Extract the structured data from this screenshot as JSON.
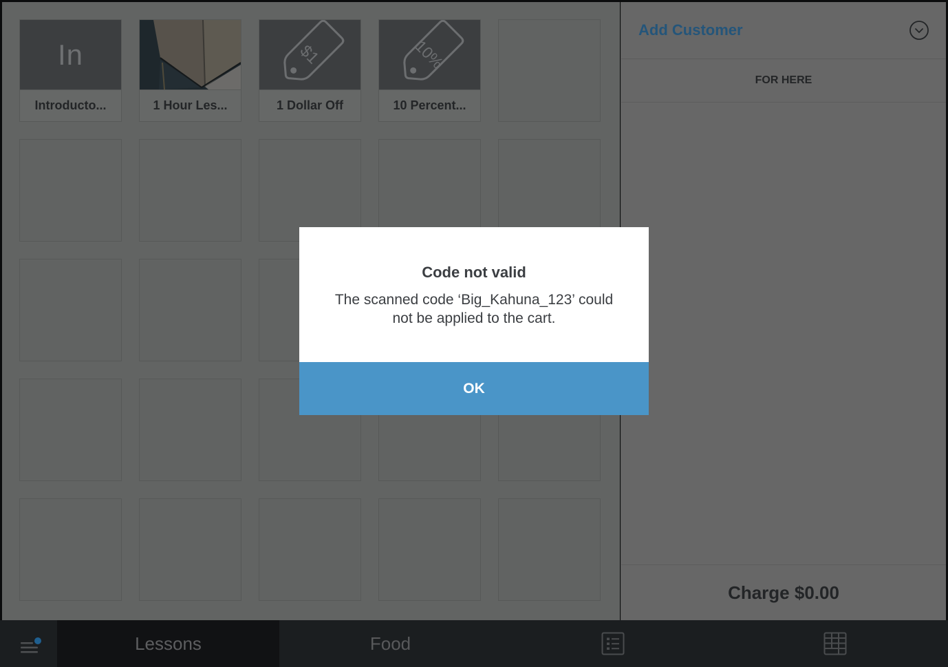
{
  "items_grid": {
    "tiles": [
      {
        "label": "Introducto...",
        "thumb_type": "initials",
        "initials": "In"
      },
      {
        "label": "1 Hour Les...",
        "thumb_type": "photo"
      },
      {
        "label": "1 Dollar Off",
        "thumb_type": "discount-tag",
        "tag_text": "$1"
      },
      {
        "label": "10 Percent...",
        "thumb_type": "discount-tag",
        "tag_text": "10%"
      },
      {
        "label": null,
        "thumb_type": "empty"
      }
    ],
    "empty_tile_count": 20
  },
  "cart": {
    "add_customer_label": "Add Customer",
    "customer_menu_icon": "chevron-down-circle-icon",
    "dining_option": "FOR HERE",
    "charge_label": "Charge $0.00"
  },
  "bottom_nav": {
    "menu_icon": "hamburger-menu-icon",
    "has_notification_dot": true,
    "tabs": [
      {
        "label": "Lessons",
        "selected": true
      },
      {
        "label": "Food",
        "selected": false
      }
    ],
    "icon_tabs": [
      {
        "icon": "list-icon"
      },
      {
        "icon": "keypad-grid-icon"
      }
    ]
  },
  "dialog": {
    "title": "Code not valid",
    "message": "The scanned code ‘Big_Kahuna_123’ could not be applied to the cart.",
    "ok_label": "OK"
  },
  "colors": {
    "accent_blue": "#4a95c8",
    "link_blue": "#24557a",
    "notification_dot": "#1f5f8f"
  }
}
